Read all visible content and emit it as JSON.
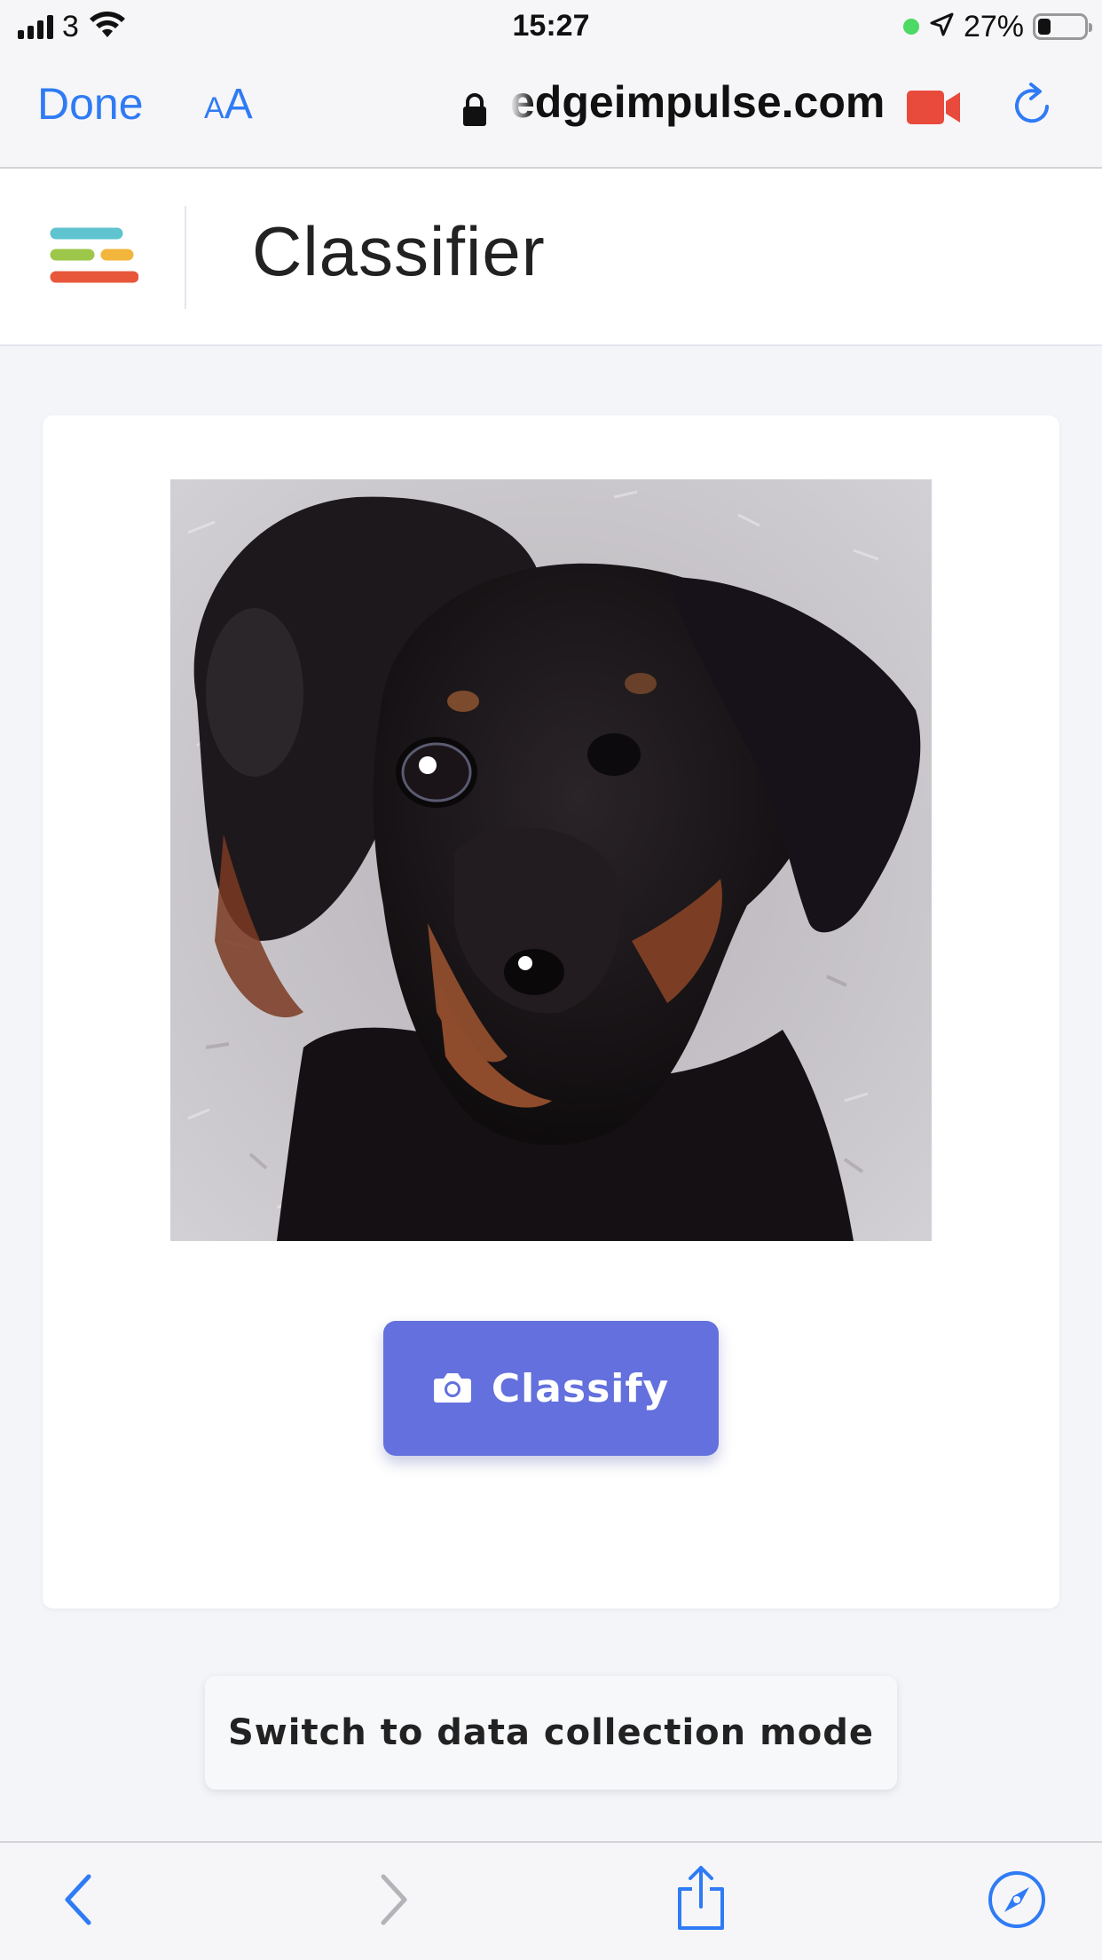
{
  "status_bar": {
    "carrier": "3",
    "time": "15:27",
    "battery_percent": "27%",
    "battery_level": 0.27,
    "signal_bars": 4
  },
  "browser": {
    "done_label": "Done",
    "text_size_label_small": "A",
    "text_size_label_large": "A",
    "url": "edgeimpulse.com",
    "accent_color": "#2f7bf5",
    "recording_color": "#e84a3c"
  },
  "header": {
    "title": "Classifier",
    "logo_colors": [
      "#5fc3d0",
      "#9dc74a",
      "#f2b63c",
      "#e8573a"
    ]
  },
  "main": {
    "preview_subject": "camera preview of a black and tan puppy",
    "classify_label": "Classify",
    "classify_icon": "camera-icon",
    "button_color": "#6370dd"
  },
  "footer": {
    "switch_mode_label": "Switch to data collection mode"
  },
  "bottom_bar": {
    "icons": [
      "back-icon",
      "forward-icon",
      "share-icon",
      "compass-icon"
    ]
  }
}
